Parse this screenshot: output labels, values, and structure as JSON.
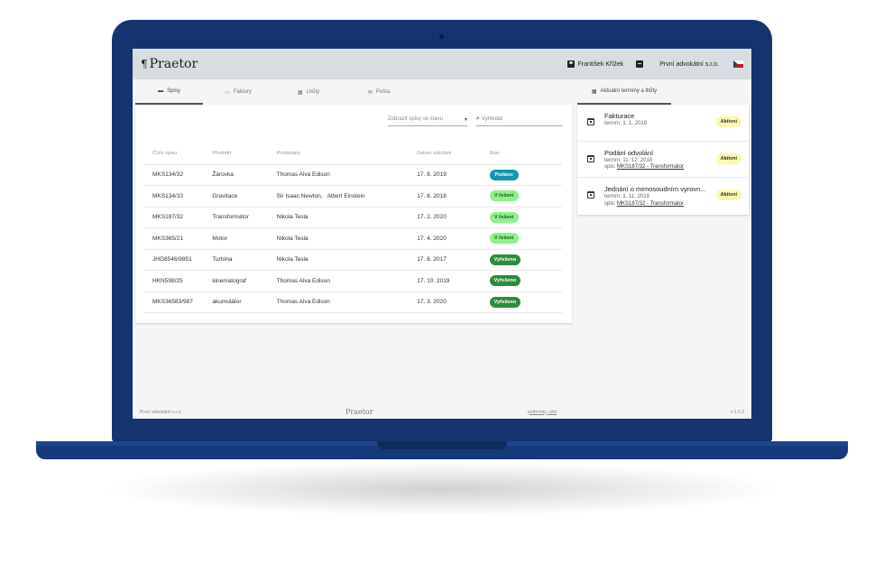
{
  "app": {
    "logo_text": "Praetor",
    "logo_mark": "¶"
  },
  "header": {
    "user_name": "František Křížek",
    "company": "První advokátní s.r.o."
  },
  "tabs": [
    {
      "label": "Spisy",
      "icon": "folder-icon",
      "active": true
    },
    {
      "label": "Faktury",
      "icon": "invoice-icon",
      "active": false
    },
    {
      "label": "Lhůty",
      "icon": "calendar-icon",
      "active": false
    },
    {
      "label": "Pošta",
      "icon": "mail-icon",
      "active": false
    }
  ],
  "right_tab": {
    "label": "Aktuální termíny a lhůty",
    "icon": "calendar-icon"
  },
  "filters": {
    "status_select": "Zobrazit spisy ve stavu",
    "search_placeholder": "Vyhledat"
  },
  "table": {
    "headers": [
      "Číslo spisu",
      "Předmět",
      "Protistrany",
      "Datum založení",
      "Stav"
    ],
    "rows": [
      {
        "number": "MKS134/32",
        "subject": "Žárovka",
        "parties": "Thomas Alva Edison",
        "date": "17. 8. 2019",
        "status": "Podáno",
        "status_type": "podano"
      },
      {
        "number": "MKS134/33",
        "subject": "Gravitace",
        "parties": "Sir Isaac Newton,   Albert Einstein",
        "date": "17. 8. 2018",
        "status": "V řešení",
        "status_type": "reseni"
      },
      {
        "number": "MKS187/32",
        "subject": "Transformátor",
        "parties": "Nikola Tesla",
        "date": "17. 2. 2020",
        "status": "V řešení",
        "status_type": "reseni"
      },
      {
        "number": "MKS365/21",
        "subject": "Motor",
        "parties": "Nikola Tesla",
        "date": "17. 4. 2020",
        "status": "V řešení",
        "status_type": "reseni"
      },
      {
        "number": "JHG8546/9851",
        "subject": "Turbína",
        "parties": "Nikola Tesla",
        "date": "17. 8. 2017",
        "status": "Vyřešeno",
        "status_type": "vyreseno"
      },
      {
        "number": "HKN598/25",
        "subject": "kinematograf",
        "parties": "Thomas Alva Edison",
        "date": "17. 10. 2019",
        "status": "Vyřešeno",
        "status_type": "vyreseno"
      },
      {
        "number": "MKS36583/987",
        "subject": "akumulátor",
        "parties": "Thomas Alva Edison",
        "date": "17. 3. 2020",
        "status": "Vyřešeno",
        "status_type": "vyreseno"
      }
    ]
  },
  "terms": [
    {
      "title": "Fakturace",
      "line1": "termín: 1. 1. 2019",
      "spis_prefix": "",
      "spis_link": "",
      "badge": "Aktivní"
    },
    {
      "title": "Podání odvolání",
      "line1": "termín: 11. 12. 2018",
      "spis_prefix": "spis: ",
      "spis_link": "MKS187/32 - Transformátor",
      "badge": "Aktivní"
    },
    {
      "title": "Jednání o mimosoudním vyrovn...",
      "line1": "termín: 1. 11. 2018",
      "spis_prefix": "spis: ",
      "spis_link": "MKS187/32 - Transformátor",
      "badge": "Aktivní"
    }
  ],
  "footer": {
    "company": "První advokátní s.r.o.",
    "logo": "Praetor",
    "terms_link": "podmínky užití",
    "version": "v 1.0.2"
  },
  "colors": {
    "laptop_body": "#15346f",
    "header_bg": "#d8dde2",
    "status_podano": "#1596a8",
    "status_reseni": "#8ef08e",
    "status_vyreseno": "#2e8b3c",
    "badge_active": "#fbf7b0"
  }
}
